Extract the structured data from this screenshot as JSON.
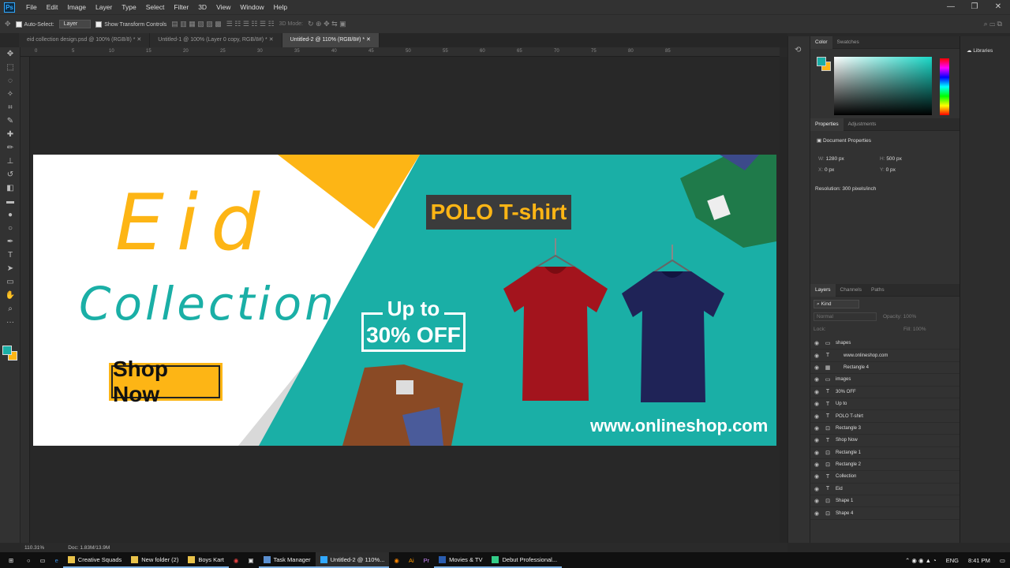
{
  "app": {
    "logo": "Ps"
  },
  "menu": [
    "File",
    "Edit",
    "Image",
    "Layer",
    "Type",
    "Select",
    "Filter",
    "3D",
    "View",
    "Window",
    "Help"
  ],
  "window_controls": [
    "—",
    "❐",
    "✕"
  ],
  "options": {
    "auto_select": "Auto-Select:",
    "auto_select_value": "Layer",
    "transform": "Show Transform Controls",
    "mode3d": "3D Mode:"
  },
  "tabs": [
    "eid collection design.psd @ 100% (RGB/8) *",
    "Untitled-1 @ 100% (Layer 0 copy, RGB/8#) *",
    "Untitled-2 @ 110% (RGB/8#) *"
  ],
  "ruler": [
    "0",
    "5",
    "10",
    "15",
    "20",
    "25",
    "30",
    "35",
    "40",
    "45",
    "50",
    "55",
    "60",
    "65",
    "70",
    "75",
    "80",
    "85"
  ],
  "banner": {
    "title": "Eid",
    "subtitle": "Collection",
    "button": "Shop Now",
    "product": "POLO T-shirt",
    "offer_line1": "Up to",
    "offer_line2": "30% OFF",
    "website": "www.onlineshop.com"
  },
  "colors": {
    "teal": "#1aafa6",
    "yellow": "#fdb515",
    "red": "#a3141d",
    "navy": "#1f2357",
    "dark_label": "#3b3b3b"
  },
  "status": {
    "zoom": "110.31%",
    "doc": "Doc: 1.83M/13.9M"
  },
  "panels": {
    "color_tab": "Color",
    "swatches_tab": "Swatches",
    "properties_tab": "Properties",
    "adjustments_tab": "Adjustments",
    "doc_props": "Document Properties",
    "w": "W:",
    "w_val": "1280 px",
    "h": "H:",
    "h_val": "500 px",
    "x": "X:",
    "x_val": "0 px",
    "y": "Y:",
    "y_val": "0 px",
    "resolution": "Resolution: 300 pixels/inch",
    "layers_tab": "Layers",
    "channels_tab": "Channels",
    "paths_tab": "Paths",
    "kind": "Kind",
    "blend": "Normal",
    "opacity": "Opacity:",
    "opacity_val": "100%",
    "lock": "Lock:",
    "fill": "Fill:",
    "fill_val": "100%",
    "libraries": "Libraries"
  },
  "layers": [
    {
      "name": "shapes",
      "type": "folder"
    },
    {
      "name": "www.onlineshop.com",
      "type": "text"
    },
    {
      "name": "Rectangle 4",
      "type": "raster"
    },
    {
      "name": "images",
      "type": "folder"
    },
    {
      "name": "30% OFF",
      "type": "text"
    },
    {
      "name": "Up to",
      "type": "text"
    },
    {
      "name": "POLO T-shirt",
      "type": "text"
    },
    {
      "name": "Rectangle 3",
      "type": "shape"
    },
    {
      "name": "Shop Now",
      "type": "text"
    },
    {
      "name": "Rectangle 1",
      "type": "shape"
    },
    {
      "name": "Rectangle 2",
      "type": "shape"
    },
    {
      "name": "Collection",
      "type": "text"
    },
    {
      "name": "Eid",
      "type": "text"
    },
    {
      "name": "Shape 1",
      "type": "shape"
    },
    {
      "name": "Shape 4",
      "type": "shape"
    }
  ],
  "taskbar": {
    "items": [
      "Creative Squads",
      "New folder (2)",
      "Boys Kart",
      "Task Manager",
      "Untitled-2 @ 110%...",
      "Movies & TV",
      "Debut Professional..."
    ],
    "lang": "ENG",
    "time": "8:41 PM"
  }
}
